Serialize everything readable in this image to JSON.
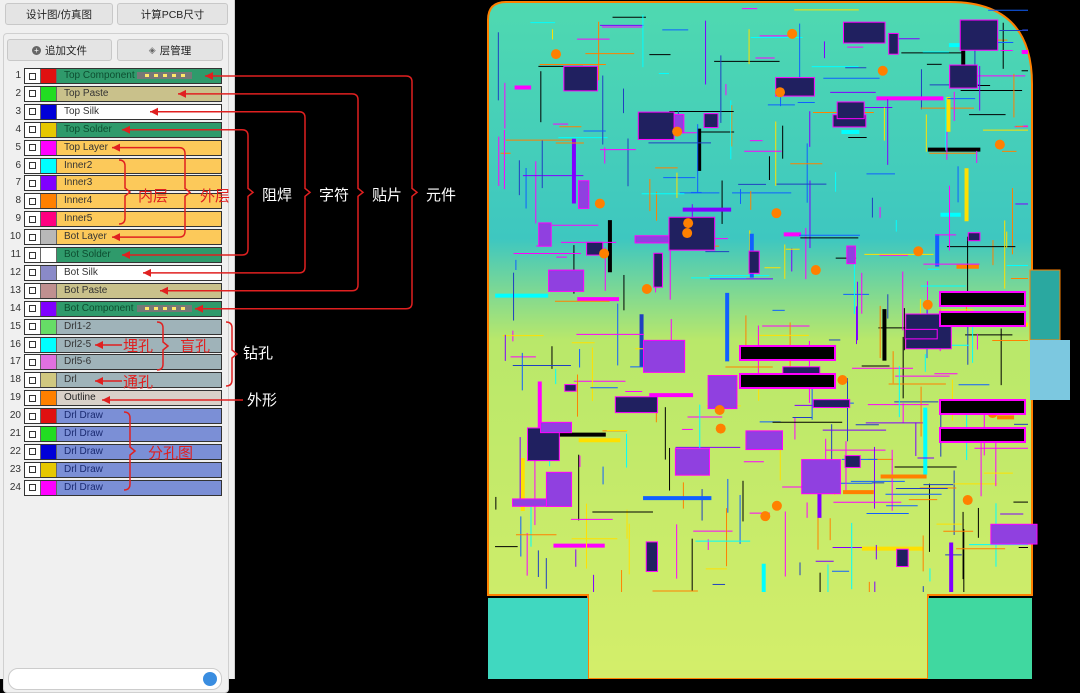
{
  "toolbar": {
    "design_view": "设计图/仿真图",
    "calc_pcb_size": "计算PCB尺寸",
    "add_file": "追加文件",
    "layer_manage": "层管理"
  },
  "layers": [
    {
      "n": "1",
      "name": "Top Component",
      "color": "#e01010",
      "bg": "#2f9a6b",
      "fg": "#0d4d30",
      "pads": true
    },
    {
      "n": "2",
      "name": "Top Paste",
      "color": "#22dd22",
      "bg": "#c9c18b",
      "fg": "#333"
    },
    {
      "n": "3",
      "name": "Top Silk",
      "color": "#0000d8",
      "bg": "#ffffff",
      "fg": "#333"
    },
    {
      "n": "4",
      "name": "Top Solder",
      "color": "#e6c800",
      "bg": "#2f9a6b",
      "fg": "#0d4d30"
    },
    {
      "n": "5",
      "name": "Top Layer",
      "color": "#ff00ff",
      "bg": "#fcc95a",
      "fg": "#333"
    },
    {
      "n": "6",
      "name": "Inner2",
      "color": "#00ffff",
      "bg": "#fcc95a",
      "fg": "#333"
    },
    {
      "n": "7",
      "name": "Inner3",
      "color": "#8000ff",
      "bg": "#fcc95a",
      "fg": "#333"
    },
    {
      "n": "8",
      "name": "Inner4",
      "color": "#ff8000",
      "bg": "#fcc95a",
      "fg": "#333"
    },
    {
      "n": "9",
      "name": "Inner5",
      "color": "#ff0080",
      "bg": "#fcc95a",
      "fg": "#333"
    },
    {
      "n": "10",
      "name": "Bot Layer",
      "color": "#b8b8b8",
      "bg": "#fcc95a",
      "fg": "#333"
    },
    {
      "n": "11",
      "name": "Bot Solder",
      "color": "#ffffff",
      "bg": "#2f9a6b",
      "fg": "#0d4d30"
    },
    {
      "n": "12",
      "name": "Bot Silk",
      "color": "#8a8ac8",
      "bg": "#ffffff",
      "fg": "#333"
    },
    {
      "n": "13",
      "name": "Bot Paste",
      "color": "#c09090",
      "bg": "#c9c18b",
      "fg": "#333"
    },
    {
      "n": "14",
      "name": "Bot Component",
      "color": "#8000ff",
      "bg": "#2f9a6b",
      "fg": "#0d4d30",
      "pads": true
    },
    {
      "n": "15",
      "name": "Drl1-2",
      "color": "#66dd66",
      "bg": "#9fb3b9",
      "fg": "#333"
    },
    {
      "n": "16",
      "name": "Drl2-5",
      "color": "#00ffff",
      "bg": "#9fb3b9",
      "fg": "#333"
    },
    {
      "n": "17",
      "name": "Drl5-6",
      "color": "#e070e0",
      "bg": "#9fb3b9",
      "fg": "#333"
    },
    {
      "n": "18",
      "name": "Drl",
      "color": "#d0c880",
      "bg": "#9fb3b9",
      "fg": "#333"
    },
    {
      "n": "19",
      "name": "Outline",
      "color": "#ff8000",
      "bg": "#d9d0c8",
      "fg": "#222"
    },
    {
      "n": "20",
      "name": "Drl Draw",
      "color": "#e01010",
      "bg": "#7b8fd6",
      "fg": "#1a2a70"
    },
    {
      "n": "21",
      "name": "Drl Draw",
      "color": "#22dd22",
      "bg": "#7b8fd6",
      "fg": "#1a2a70"
    },
    {
      "n": "22",
      "name": "Drl Draw",
      "color": "#0000d8",
      "bg": "#7b8fd6",
      "fg": "#1a2a70"
    },
    {
      "n": "23",
      "name": "Drl Draw",
      "color": "#e6c800",
      "bg": "#7b8fd6",
      "fg": "#1a2a70"
    },
    {
      "n": "24",
      "name": "Drl Draw",
      "color": "#ff00ff",
      "bg": "#7b8fd6",
      "fg": "#1a2a70"
    }
  ],
  "annotations": {
    "inner": "内层",
    "outer": "外层",
    "solder": "阻焊",
    "silk": "字符",
    "paste": "贴片",
    "component": "元件",
    "drill": "钻孔",
    "outline": "外形",
    "buried": "埋孔",
    "blind": "盲孔",
    "through": "通孔",
    "drill_map": "分孔图"
  },
  "colors": {
    "annotation_red": "#e02020",
    "annotation_white": "#ffffff"
  }
}
